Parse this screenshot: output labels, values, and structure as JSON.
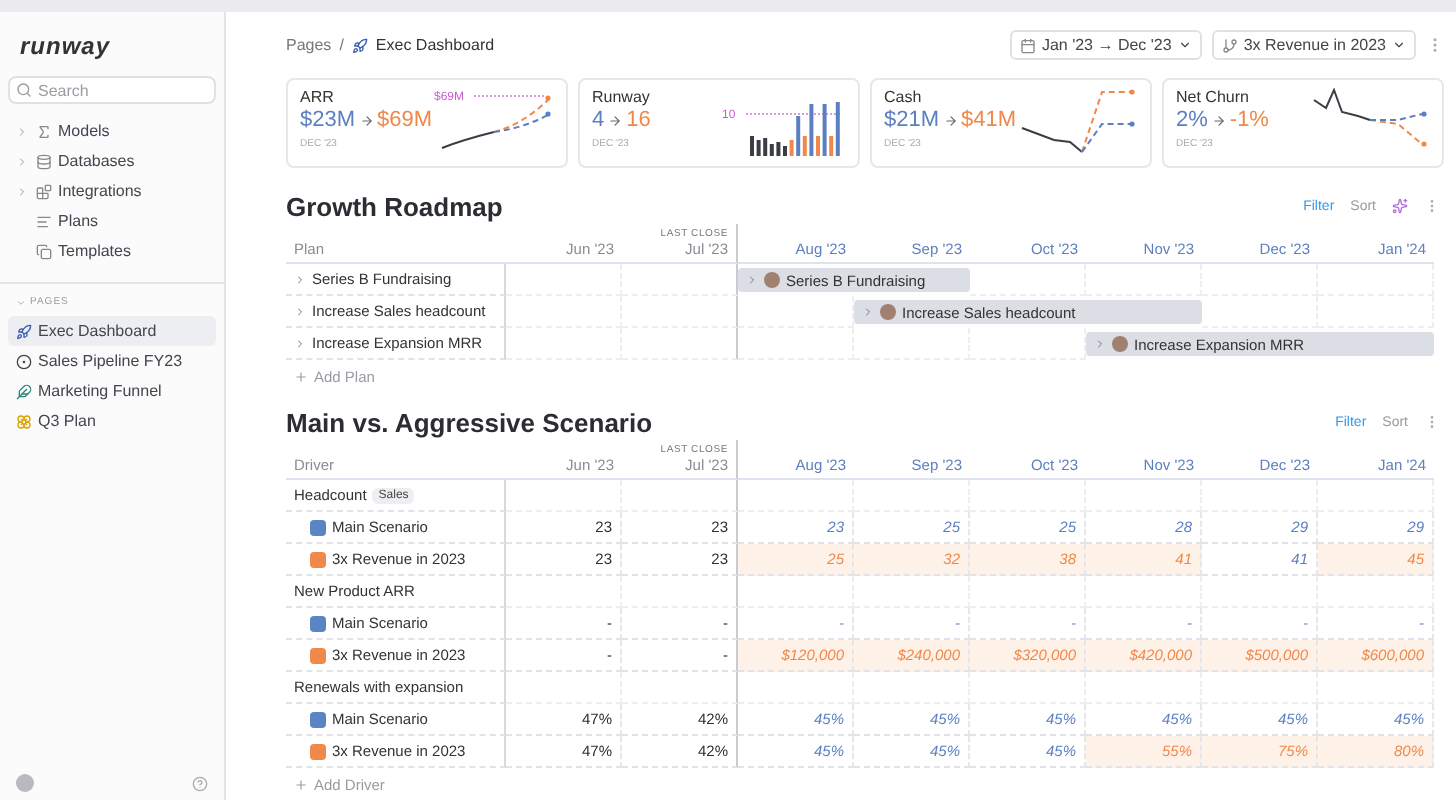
{
  "sidebar": {
    "logo": "runway",
    "search": {
      "placeholder": "Search"
    },
    "nav": [
      {
        "label": "Models",
        "kind": "group",
        "expanded": false
      },
      {
        "label": "Databases",
        "kind": "group",
        "expanded": false
      },
      {
        "label": "Integrations",
        "kind": "group",
        "expanded": false
      },
      {
        "label": "Plans",
        "kind": "link"
      },
      {
        "label": "Templates",
        "kind": "link"
      }
    ],
    "pages_heading": {
      "label": "PAGES",
      "expanded": true
    },
    "pages": [
      {
        "label": "Exec Dashboard",
        "selected": true
      },
      {
        "label": "Sales Pipeline FY23",
        "selected": false
      },
      {
        "label": "Marketing Funnel",
        "selected": false
      },
      {
        "label": "Q3 Plan",
        "selected": false
      }
    ]
  },
  "breadcrumb": {
    "root": "Pages",
    "separator": "/",
    "current": "Exec Dashboard"
  },
  "toolbar": {
    "date_range": "Jan '23 → Dec '23",
    "scenario": "3x Revenue in 2023"
  },
  "metrics": [
    {
      "title": "ARR",
      "from": "$23M",
      "to": "$69M",
      "period": "DEC '23",
      "kind": "line",
      "marker_label": "$69M"
    },
    {
      "title": "Runway",
      "from": "4",
      "to": "16",
      "period": "DEC '23",
      "kind": "bars",
      "marker_label": "10"
    },
    {
      "title": "Cash",
      "from": "$21M",
      "to": "$41M",
      "period": "DEC '23",
      "kind": "line"
    },
    {
      "title": "Net Churn",
      "from": "2%",
      "to": "-1%",
      "period": "DEC '23",
      "kind": "line"
    }
  ],
  "roadmap": {
    "title": "Growth Roadmap",
    "filter": "Filter",
    "sort": "Sort",
    "first_column": "Plan",
    "columns": [
      {
        "label": "Jun '23",
        "forecast": false
      },
      {
        "label": "Jul '23",
        "forecast": false,
        "caption": "LAST CLOSE"
      },
      {
        "label": "Aug '23",
        "forecast": true
      },
      {
        "label": "Sep '23",
        "forecast": true
      },
      {
        "label": "Oct '23",
        "forecast": true
      },
      {
        "label": "Nov '23",
        "forecast": true
      },
      {
        "label": "Dec '23",
        "forecast": true
      },
      {
        "label": "Jan '24",
        "forecast": true
      }
    ],
    "plans": [
      {
        "label": "Series B Fundraising",
        "expanded": false,
        "bar_label": "Series B Fundraising",
        "covered": [
          false,
          false,
          true,
          true,
          false,
          false,
          false,
          false
        ]
      },
      {
        "label": "Increase Sales headcount",
        "expanded": false,
        "bar_label": "Increase Sales headcount",
        "covered": [
          false,
          false,
          false,
          true,
          true,
          true,
          false,
          false
        ]
      },
      {
        "label": "Increase Expansion MRR",
        "expanded": false,
        "bar_label": "Increase Expansion MRR",
        "covered": [
          false,
          false,
          false,
          false,
          false,
          true,
          true,
          true
        ]
      }
    ],
    "add": "Add Plan"
  },
  "scenario": {
    "title": "Main vs. Aggressive Scenario",
    "filter": "Filter",
    "sort": "Sort",
    "first_column": "Driver",
    "columns": [
      {
        "label": "Jun '23",
        "forecast": false
      },
      {
        "label": "Jul '23",
        "forecast": false,
        "caption": "LAST CLOSE"
      },
      {
        "label": "Aug '23",
        "forecast": true
      },
      {
        "label": "Sep '23",
        "forecast": true
      },
      {
        "label": "Oct '23",
        "forecast": true
      },
      {
        "label": "Nov '23",
        "forecast": true
      },
      {
        "label": "Dec '23",
        "forecast": true
      },
      {
        "label": "Jan '24",
        "forecast": true
      }
    ],
    "groups": [
      {
        "label": "Headcount",
        "tag": "Sales",
        "rows": [
          {
            "label": "Main Scenario",
            "color": "#5b84c4",
            "cells": [
              {
                "value": "23",
                "forecast": false,
                "changed": false
              },
              {
                "value": "23",
                "forecast": false,
                "changed": false
              },
              {
                "value": "23",
                "forecast": true,
                "changed": false
              },
              {
                "value": "25",
                "forecast": true,
                "changed": false
              },
              {
                "value": "25",
                "forecast": true,
                "changed": false
              },
              {
                "value": "28",
                "forecast": true,
                "changed": false
              },
              {
                "value": "29",
                "forecast": true,
                "changed": false
              },
              {
                "value": "29",
                "forecast": true,
                "changed": false
              }
            ]
          },
          {
            "label": "3x Revenue in 2023",
            "color": "#f0884a",
            "cells": [
              {
                "value": "23",
                "forecast": false,
                "changed": false
              },
              {
                "value": "23",
                "forecast": false,
                "changed": false
              },
              {
                "value": "25",
                "forecast": true,
                "changed": true
              },
              {
                "value": "32",
                "forecast": true,
                "changed": true
              },
              {
                "value": "38",
                "forecast": true,
                "changed": true
              },
              {
                "value": "41",
                "forecast": true,
                "changed": true
              },
              {
                "value": "41",
                "forecast": true,
                "changed": false
              },
              {
                "value": "45",
                "forecast": true,
                "changed": true
              }
            ]
          }
        ]
      },
      {
        "label": "New Product ARR",
        "rows": [
          {
            "label": "Main Scenario",
            "color": "#5b84c4",
            "cells": [
              {
                "value": "-",
                "forecast": false,
                "changed": false
              },
              {
                "value": "-",
                "forecast": false,
                "changed": false
              },
              {
                "value": "-",
                "forecast": true,
                "changed": false
              },
              {
                "value": "-",
                "forecast": true,
                "changed": false
              },
              {
                "value": "-",
                "forecast": true,
                "changed": false
              },
              {
                "value": "-",
                "forecast": true,
                "changed": false
              },
              {
                "value": "-",
                "forecast": true,
                "changed": false
              },
              {
                "value": "-",
                "forecast": true,
                "changed": false
              }
            ]
          },
          {
            "label": "3x Revenue in 2023",
            "color": "#f0884a",
            "cells": [
              {
                "value": "-",
                "forecast": false,
                "changed": false
              },
              {
                "value": "-",
                "forecast": false,
                "changed": false
              },
              {
                "value": "$120,000",
                "forecast": true,
                "changed": true
              },
              {
                "value": "$240,000",
                "forecast": true,
                "changed": true
              },
              {
                "value": "$320,000",
                "forecast": true,
                "changed": true
              },
              {
                "value": "$420,000",
                "forecast": true,
                "changed": true
              },
              {
                "value": "$500,000",
                "forecast": true,
                "changed": true
              },
              {
                "value": "$600,000",
                "forecast": true,
                "changed": true
              }
            ]
          }
        ]
      },
      {
        "label": "Renewals with expansion",
        "rows": [
          {
            "label": "Main Scenario",
            "color": "#5b84c4",
            "cells": [
              {
                "value": "47%",
                "forecast": false,
                "changed": false
              },
              {
                "value": "42%",
                "forecast": false,
                "changed": false
              },
              {
                "value": "45%",
                "forecast": true,
                "changed": false
              },
              {
                "value": "45%",
                "forecast": true,
                "changed": false
              },
              {
                "value": "45%",
                "forecast": true,
                "changed": false
              },
              {
                "value": "45%",
                "forecast": true,
                "changed": false
              },
              {
                "value": "45%",
                "forecast": true,
                "changed": false
              },
              {
                "value": "45%",
                "forecast": true,
                "changed": false
              }
            ]
          },
          {
            "label": "3x Revenue in 2023",
            "color": "#f0884a",
            "cells": [
              {
                "value": "47%",
                "forecast": false,
                "changed": false
              },
              {
                "value": "42%",
                "forecast": false,
                "changed": false
              },
              {
                "value": "45%",
                "forecast": true,
                "changed": false
              },
              {
                "value": "45%",
                "forecast": true,
                "changed": false
              },
              {
                "value": "45%",
                "forecast": true,
                "changed": false
              },
              {
                "value": "55%",
                "forecast": true,
                "changed": true
              },
              {
                "value": "75%",
                "forecast": true,
                "changed": true
              },
              {
                "value": "80%",
                "forecast": true,
                "changed": true
              }
            ]
          }
        ]
      }
    ],
    "add": "Add Driver"
  }
}
